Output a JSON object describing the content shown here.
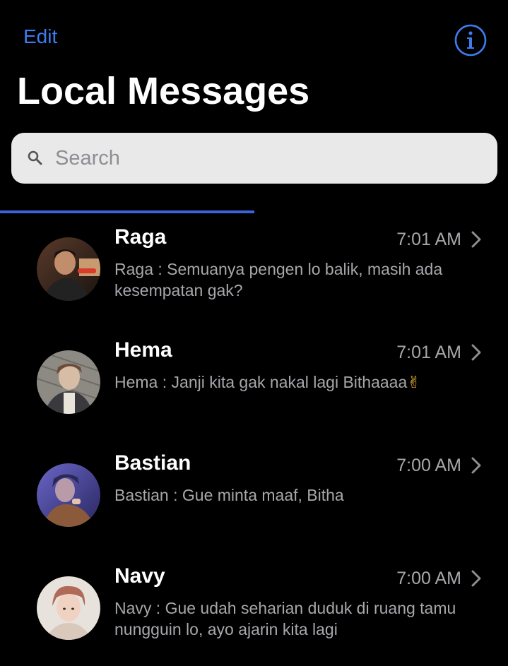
{
  "header": {
    "edit_label": "Edit",
    "info_icon": "info-circle-icon",
    "title": "Local Messages"
  },
  "search": {
    "placeholder": "Search",
    "value": "",
    "icon": "magnifier-icon"
  },
  "progress": {
    "fraction": 0.5,
    "color": "#3e63d8"
  },
  "colors": {
    "accent": "#3d7cf0",
    "background": "#000000",
    "secondary_text": "#a7a7ac",
    "search_background": "#e9e9ea"
  },
  "conversations": [
    {
      "name": "Raga",
      "time": "7:01 AM",
      "preview": "Raga : Semuanya pengen lo balik, masih ada kesempatan gak?",
      "emoji": ""
    },
    {
      "name": "Hema",
      "time": "7:01 AM",
      "preview": "Hema : Janji kita gak nakal lagi Bithaaaa",
      "emoji": "✌"
    },
    {
      "name": "Bastian",
      "time": "7:00 AM",
      "preview": "Bastian : Gue minta maaf, Bitha",
      "emoji": ""
    },
    {
      "name": "Navy",
      "time": "7:00 AM",
      "preview": "Navy : Gue udah seharian duduk di ruang tamu nungguin lo, ayo ajarin kita lagi",
      "emoji": ""
    }
  ]
}
